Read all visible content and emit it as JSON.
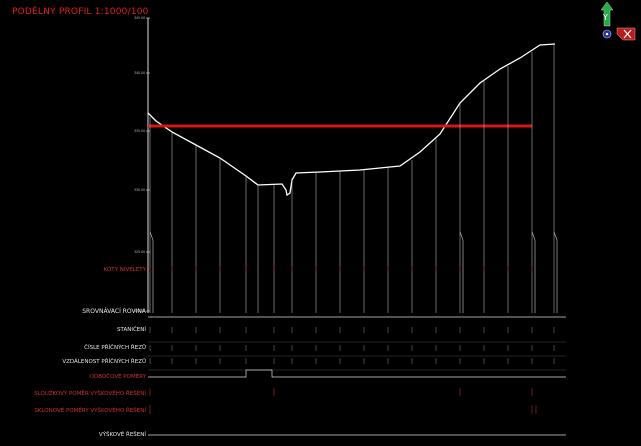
{
  "drawing": {
    "title": "PODÉLNÝ PROFIL 1:1000/100",
    "comparison_plane_label": "SROVNÁVACÍ ROVINA",
    "row_labels": [
      {
        "text": "KÓTY NIVELETY",
        "color": "#d03030"
      },
      {
        "text": "STANIČENÍ",
        "color": "#e8e8e8"
      },
      {
        "text": "ČÍSLE PŘÍČNÝCH ŘEZŮ",
        "color": "#e8e8e8"
      },
      {
        "text": "VZDÁLENOST PŘÍČNÝCH ŘEZŮ",
        "color": "#e8e8e8"
      },
      {
        "text": "ODBOČOVÉ POMĚRY",
        "color": "#d03030"
      },
      {
        "text": "SLOUŽKOVÝ POMĚR VYŠKOVÉHO ŘEŠENÍ",
        "color": "#d03030"
      },
      {
        "text": "SKLONOVÉ POMĚRY VÝŠKOVÉHO ŘEŠENÍ",
        "color": "#d03030"
      },
      {
        "text": "VÝŠKOVÉ ŘEŠENÍ",
        "color": "#e8e8e8"
      }
    ],
    "profile_line_color": "#d01818",
    "terrain_color": "#ffffff"
  },
  "viewcube": {
    "axis_label": "Y",
    "icons": [
      "compass-icon",
      "close-icon"
    ]
  }
}
